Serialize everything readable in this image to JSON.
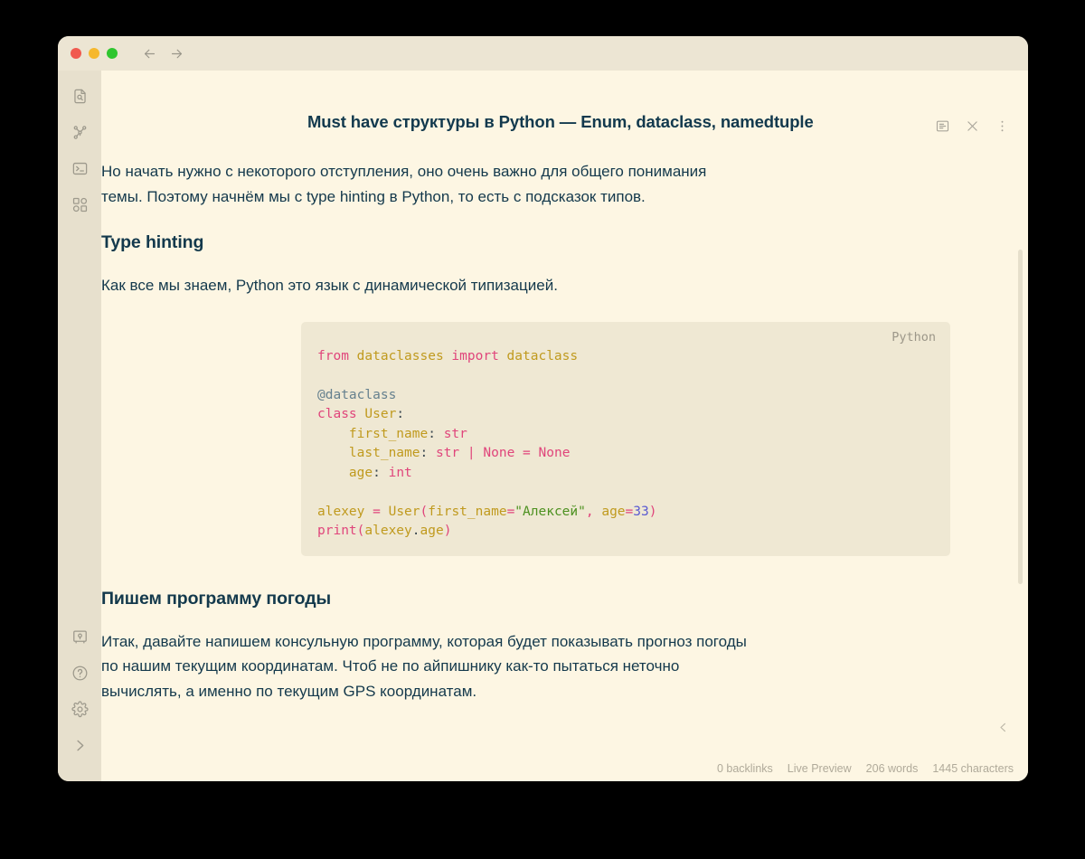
{
  "window": {
    "traffic_lights": [
      {
        "name": "close",
        "color": "#f05a4f"
      },
      {
        "name": "minimize",
        "color": "#f6b82d"
      },
      {
        "name": "maximize",
        "color": "#2fc62f"
      }
    ],
    "nav": {
      "back": "←",
      "forward": "→"
    }
  },
  "ribbon": {
    "top_items": [
      {
        "name": "quick-switcher-icon",
        "label": "Quick switcher"
      },
      {
        "name": "graph-view-icon",
        "label": "Graph view"
      },
      {
        "name": "terminal-icon",
        "label": "Terminal"
      },
      {
        "name": "canvas-icon",
        "label": "Canvas"
      }
    ],
    "bottom_items": [
      {
        "name": "vault-icon",
        "label": "Open another vault"
      },
      {
        "name": "help-icon",
        "label": "Help"
      },
      {
        "name": "settings-icon",
        "label": "Settings"
      },
      {
        "name": "expand-sidebar-icon",
        "label": "Expand sidebar"
      }
    ]
  },
  "note": {
    "title": "Must have структуры в Python — Enum, dataclass, namedtuple",
    "actions": [
      {
        "name": "reading-view-icon",
        "label": "Reading view"
      },
      {
        "name": "close-icon",
        "label": "Close"
      },
      {
        "name": "more-options-icon",
        "label": "More options"
      }
    ]
  },
  "document": {
    "intro_paragraph": "Но начать нужно с некоторого отступления, оно очень важно для общего понимания темы. Поэтому начнём мы с type hinting в Python, то есть с подсказок типов.",
    "heading_type_hinting": "Type hinting",
    "para_dynamic_typing": "Как все мы знаем, Python это язык с динамической типизацией.",
    "code_block": {
      "language": "Python",
      "lines": [
        {
          "tokens": [
            {
              "t": "from",
              "c": "kw"
            },
            {
              "t": " ",
              "c": "pl"
            },
            {
              "t": "dataclasses",
              "c": "id"
            },
            {
              "t": " ",
              "c": "pl"
            },
            {
              "t": "import",
              "c": "kw"
            },
            {
              "t": " ",
              "c": "pl"
            },
            {
              "t": "dataclass",
              "c": "id"
            }
          ]
        },
        {
          "tokens": []
        },
        {
          "tokens": [
            {
              "t": "@dataclass",
              "c": "dec"
            }
          ]
        },
        {
          "tokens": [
            {
              "t": "class",
              "c": "kw"
            },
            {
              "t": " ",
              "c": "pl"
            },
            {
              "t": "User",
              "c": "id"
            },
            {
              "t": ":",
              "c": "pl"
            }
          ]
        },
        {
          "tokens": [
            {
              "t": "    ",
              "c": "pl"
            },
            {
              "t": "first_name",
              "c": "id"
            },
            {
              "t": ": ",
              "c": "pl"
            },
            {
              "t": "str",
              "c": "kw"
            }
          ]
        },
        {
          "tokens": [
            {
              "t": "    ",
              "c": "pl"
            },
            {
              "t": "last_name",
              "c": "id"
            },
            {
              "t": ": ",
              "c": "pl"
            },
            {
              "t": "str",
              "c": "kw"
            },
            {
              "t": " ",
              "c": "pl"
            },
            {
              "t": "|",
              "c": "op"
            },
            {
              "t": " ",
              "c": "pl"
            },
            {
              "t": "None",
              "c": "kw"
            },
            {
              "t": " ",
              "c": "pl"
            },
            {
              "t": "=",
              "c": "op"
            },
            {
              "t": " ",
              "c": "pl"
            },
            {
              "t": "None",
              "c": "kw"
            }
          ]
        },
        {
          "tokens": [
            {
              "t": "    ",
              "c": "pl"
            },
            {
              "t": "age",
              "c": "id"
            },
            {
              "t": ": ",
              "c": "pl"
            },
            {
              "t": "int",
              "c": "kw"
            }
          ]
        },
        {
          "tokens": []
        },
        {
          "tokens": [
            {
              "t": "alexey",
              "c": "id"
            },
            {
              "t": " ",
              "c": "pl"
            },
            {
              "t": "=",
              "c": "op"
            },
            {
              "t": " ",
              "c": "pl"
            },
            {
              "t": "User",
              "c": "id"
            },
            {
              "t": "(",
              "c": "op"
            },
            {
              "t": "first_name",
              "c": "id"
            },
            {
              "t": "=",
              "c": "op"
            },
            {
              "t": "\"Алексей\"",
              "c": "str"
            },
            {
              "t": ",",
              "c": "op"
            },
            {
              "t": " ",
              "c": "pl"
            },
            {
              "t": "age",
              "c": "id"
            },
            {
              "t": "=",
              "c": "op"
            },
            {
              "t": "33",
              "c": "num"
            },
            {
              "t": ")",
              "c": "op"
            }
          ]
        },
        {
          "tokens": [
            {
              "t": "print",
              "c": "kw"
            },
            {
              "t": "(",
              "c": "op"
            },
            {
              "t": "alexey",
              "c": "id"
            },
            {
              "t": ".",
              "c": "pl"
            },
            {
              "t": "age",
              "c": "id"
            },
            {
              "t": ")",
              "c": "op"
            }
          ]
        }
      ]
    },
    "heading_weather": "Пишем программу погоды",
    "para_weather": "Итак, давайте напишем консульную программу, которая будет показывать прогноз погоды по нашим текущим координатам. Чтоб не по айпишнику как-то пытаться неточно вычислять, а именно по текущим GPS координатам."
  },
  "statusbar": {
    "backlinks": "0 backlinks",
    "mode": "Live Preview",
    "words": "206 words",
    "characters": "1445 characters"
  },
  "right_panel": {
    "collapse_icon": "chevron-left-icon"
  },
  "colors": {
    "window_chrome": "#ece5d3",
    "ribbon_bg": "#e7e0cd",
    "content_bg": "#fdf6e3",
    "code_bg": "#efe8d3",
    "text": "#14394c",
    "muted": "#b0aa9a",
    "kw": "#e0457b",
    "identifier": "#c09a1e",
    "decorator": "#65808e",
    "string": "#4d9120",
    "number": "#5a5ad1"
  }
}
